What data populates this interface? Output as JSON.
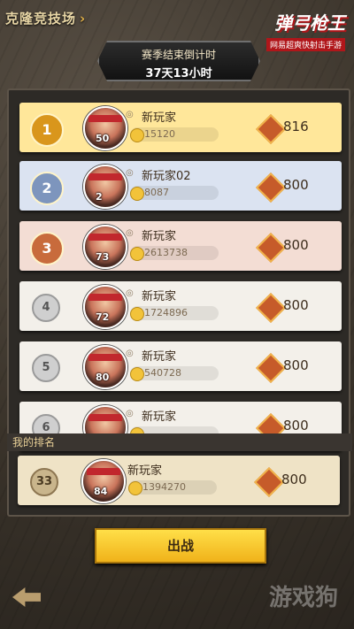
{
  "header": {
    "title": "克隆竞技场",
    "logo_main": "弹弓枪王",
    "logo_sub": "网易超爽快射击手游"
  },
  "countdown": {
    "label": "赛季结束倒计时",
    "time": "37天13小时"
  },
  "rows": [
    {
      "rank": "1",
      "level": "50",
      "name": "新玩家",
      "gold": "15120",
      "score": "816",
      "bg": "#ffe79a",
      "medal": "#d9961c"
    },
    {
      "rank": "2",
      "level": "2",
      "name": "新玩家02",
      "gold": "8087",
      "score": "800",
      "bg": "#dbe3f1",
      "medal": "#7d95bd"
    },
    {
      "rank": "3",
      "level": "73",
      "name": "新玩家",
      "gold": "2613738",
      "score": "800",
      "bg": "#f3ddd4",
      "medal": "#c86b3c"
    },
    {
      "rank": "4",
      "level": "72",
      "name": "新玩家",
      "gold": "1724896",
      "score": "800",
      "bg": "#f3f0ea"
    },
    {
      "rank": "5",
      "level": "80",
      "name": "新玩家",
      "gold": "540728",
      "score": "800",
      "bg": "#f3f0ea"
    },
    {
      "rank": "6",
      "level": "",
      "name": "新玩家",
      "gold": "",
      "score": "800",
      "bg": "#f3f0ea"
    }
  ],
  "my_rank": {
    "label": "我的排名",
    "rank": "33",
    "level": "84",
    "name": "新玩家",
    "gold": "1394270",
    "score": "800"
  },
  "fight_button": "出战",
  "watermark": "游戏狗"
}
